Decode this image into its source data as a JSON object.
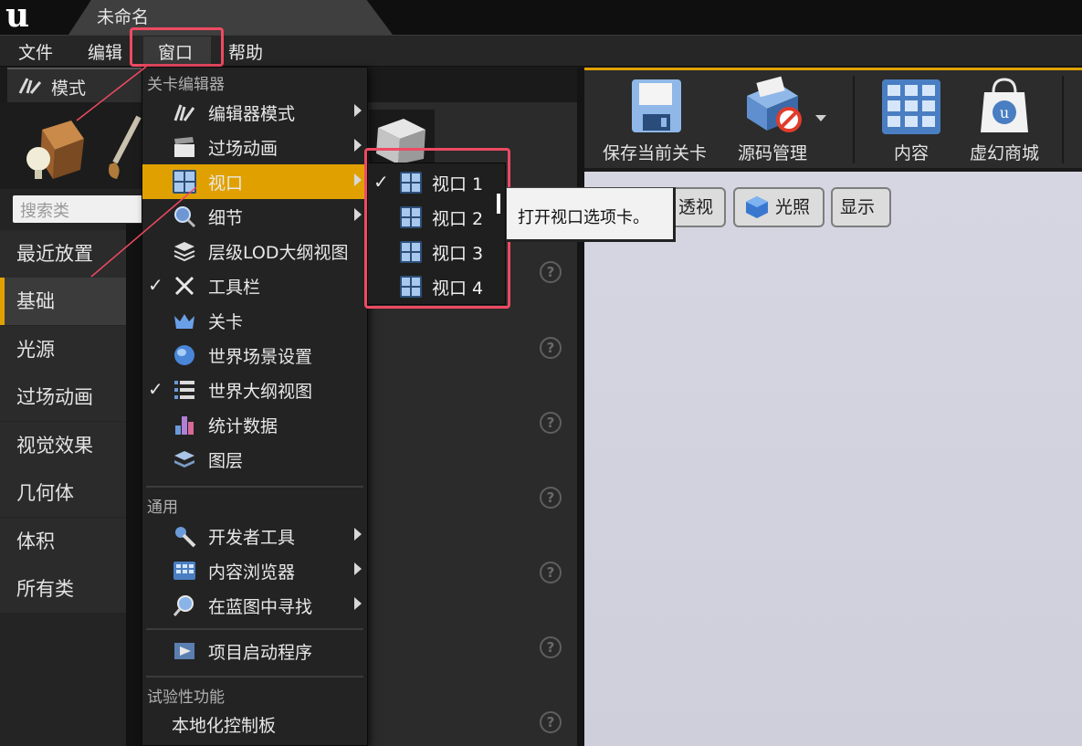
{
  "titlebar": {
    "tab_title": "未命名"
  },
  "menubar": {
    "items": [
      "文件",
      "编辑",
      "窗口",
      "帮助"
    ]
  },
  "modes": {
    "title": "模式",
    "search_placeholder": "搜索类"
  },
  "categories": [
    "最近放置",
    "基础",
    "光源",
    "过场动画",
    "视觉效果",
    "几何体",
    "体积",
    "所有类"
  ],
  "toolbar": {
    "save": "保存当前关卡",
    "source_control": "源码管理",
    "content": "内容",
    "marketplace": "虚幻商城"
  },
  "viewport": {
    "perspective": "透视",
    "lighting": "光照",
    "show": "显示"
  },
  "dropdown": {
    "section_level_editor": "关卡编辑器",
    "items_level_editor": [
      {
        "label": "编辑器模式",
        "checked": false,
        "submenu": true
      },
      {
        "label": "过场动画",
        "checked": false,
        "submenu": true
      },
      {
        "label": "视口",
        "checked": false,
        "submenu": true,
        "highlighted": true
      },
      {
        "label": "细节",
        "checked": false,
        "submenu": true
      },
      {
        "label": "层级LOD大纲视图",
        "checked": false,
        "submenu": false
      },
      {
        "label": "工具栏",
        "checked": true,
        "submenu": false
      },
      {
        "label": "关卡",
        "checked": false,
        "submenu": false
      },
      {
        "label": "世界场景设置",
        "checked": false,
        "submenu": false
      },
      {
        "label": "世界大纲视图",
        "checked": true,
        "submenu": false
      },
      {
        "label": "统计数据",
        "checked": false,
        "submenu": false
      },
      {
        "label": "图层",
        "checked": false,
        "submenu": false
      }
    ],
    "section_general": "通用",
    "items_general": [
      {
        "label": "开发者工具",
        "submenu": true
      },
      {
        "label": "内容浏览器",
        "submenu": true
      },
      {
        "label": "在蓝图中寻找",
        "submenu": true
      }
    ],
    "project_launcher": "项目启动程序",
    "section_experimental": "试验性功能",
    "localization_dashboard": "本地化控制板"
  },
  "submenu": {
    "items": [
      {
        "label": "视口 1",
        "checked": true
      },
      {
        "label": "视口 2",
        "checked": false
      },
      {
        "label": "视口 3",
        "checked": false
      },
      {
        "label": "视口 4",
        "checked": false
      }
    ]
  },
  "tooltip": {
    "text": "打开视口选项卡。"
  },
  "help_icon_text": "?",
  "colors": {
    "accent": "#e0a100",
    "annotation": "#ee4a62"
  }
}
